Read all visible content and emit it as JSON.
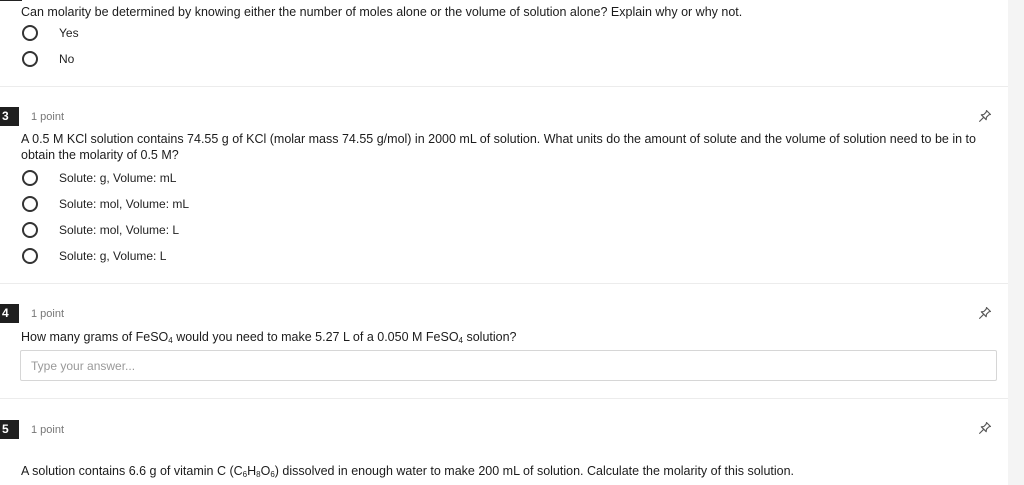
{
  "questions": [
    {
      "text": "Can molarity be determined by knowing either the number of moles alone or the volume of solution alone? Explain why or why not.",
      "options": [
        "Yes",
        "No"
      ]
    },
    {
      "number": "3",
      "points": "1 point",
      "text": "A 0.5 M KCl solution contains 74.55 g of KCl (molar mass 74.55 g/mol) in 2000 mL of solution. What units do the amount of solute and the volume of solution need to be in to obtain the molarity of 0.5 M?",
      "options": [
        "Solute: g, Volume: mL",
        "Solute: mol, Volume: mL",
        "Solute: mol, Volume: L",
        "Solute: g, Volume: L"
      ]
    },
    {
      "number": "4",
      "points": "1 point",
      "text_parts": [
        "How many grams of FeSO",
        "4",
        " would you need to make 5.27 L of a 0.050 M FeSO",
        "4",
        " solution?"
      ],
      "placeholder": "Type your answer..."
    },
    {
      "number": "5",
      "points": "1 point",
      "text_parts": [
        "A solution contains 6.6 g of vitamin C (C",
        "6",
        "H",
        "8",
        "O",
        "6",
        ") dissolved in enough water to make 200 mL of solution. Calculate the molarity of this solution."
      ]
    }
  ],
  "icons": {
    "pin": "pin-icon",
    "radio": "radio-button-icon"
  },
  "colors": {
    "badge": "#1f1f1f",
    "page": "#ffffff",
    "background": "#f4f4f4"
  }
}
